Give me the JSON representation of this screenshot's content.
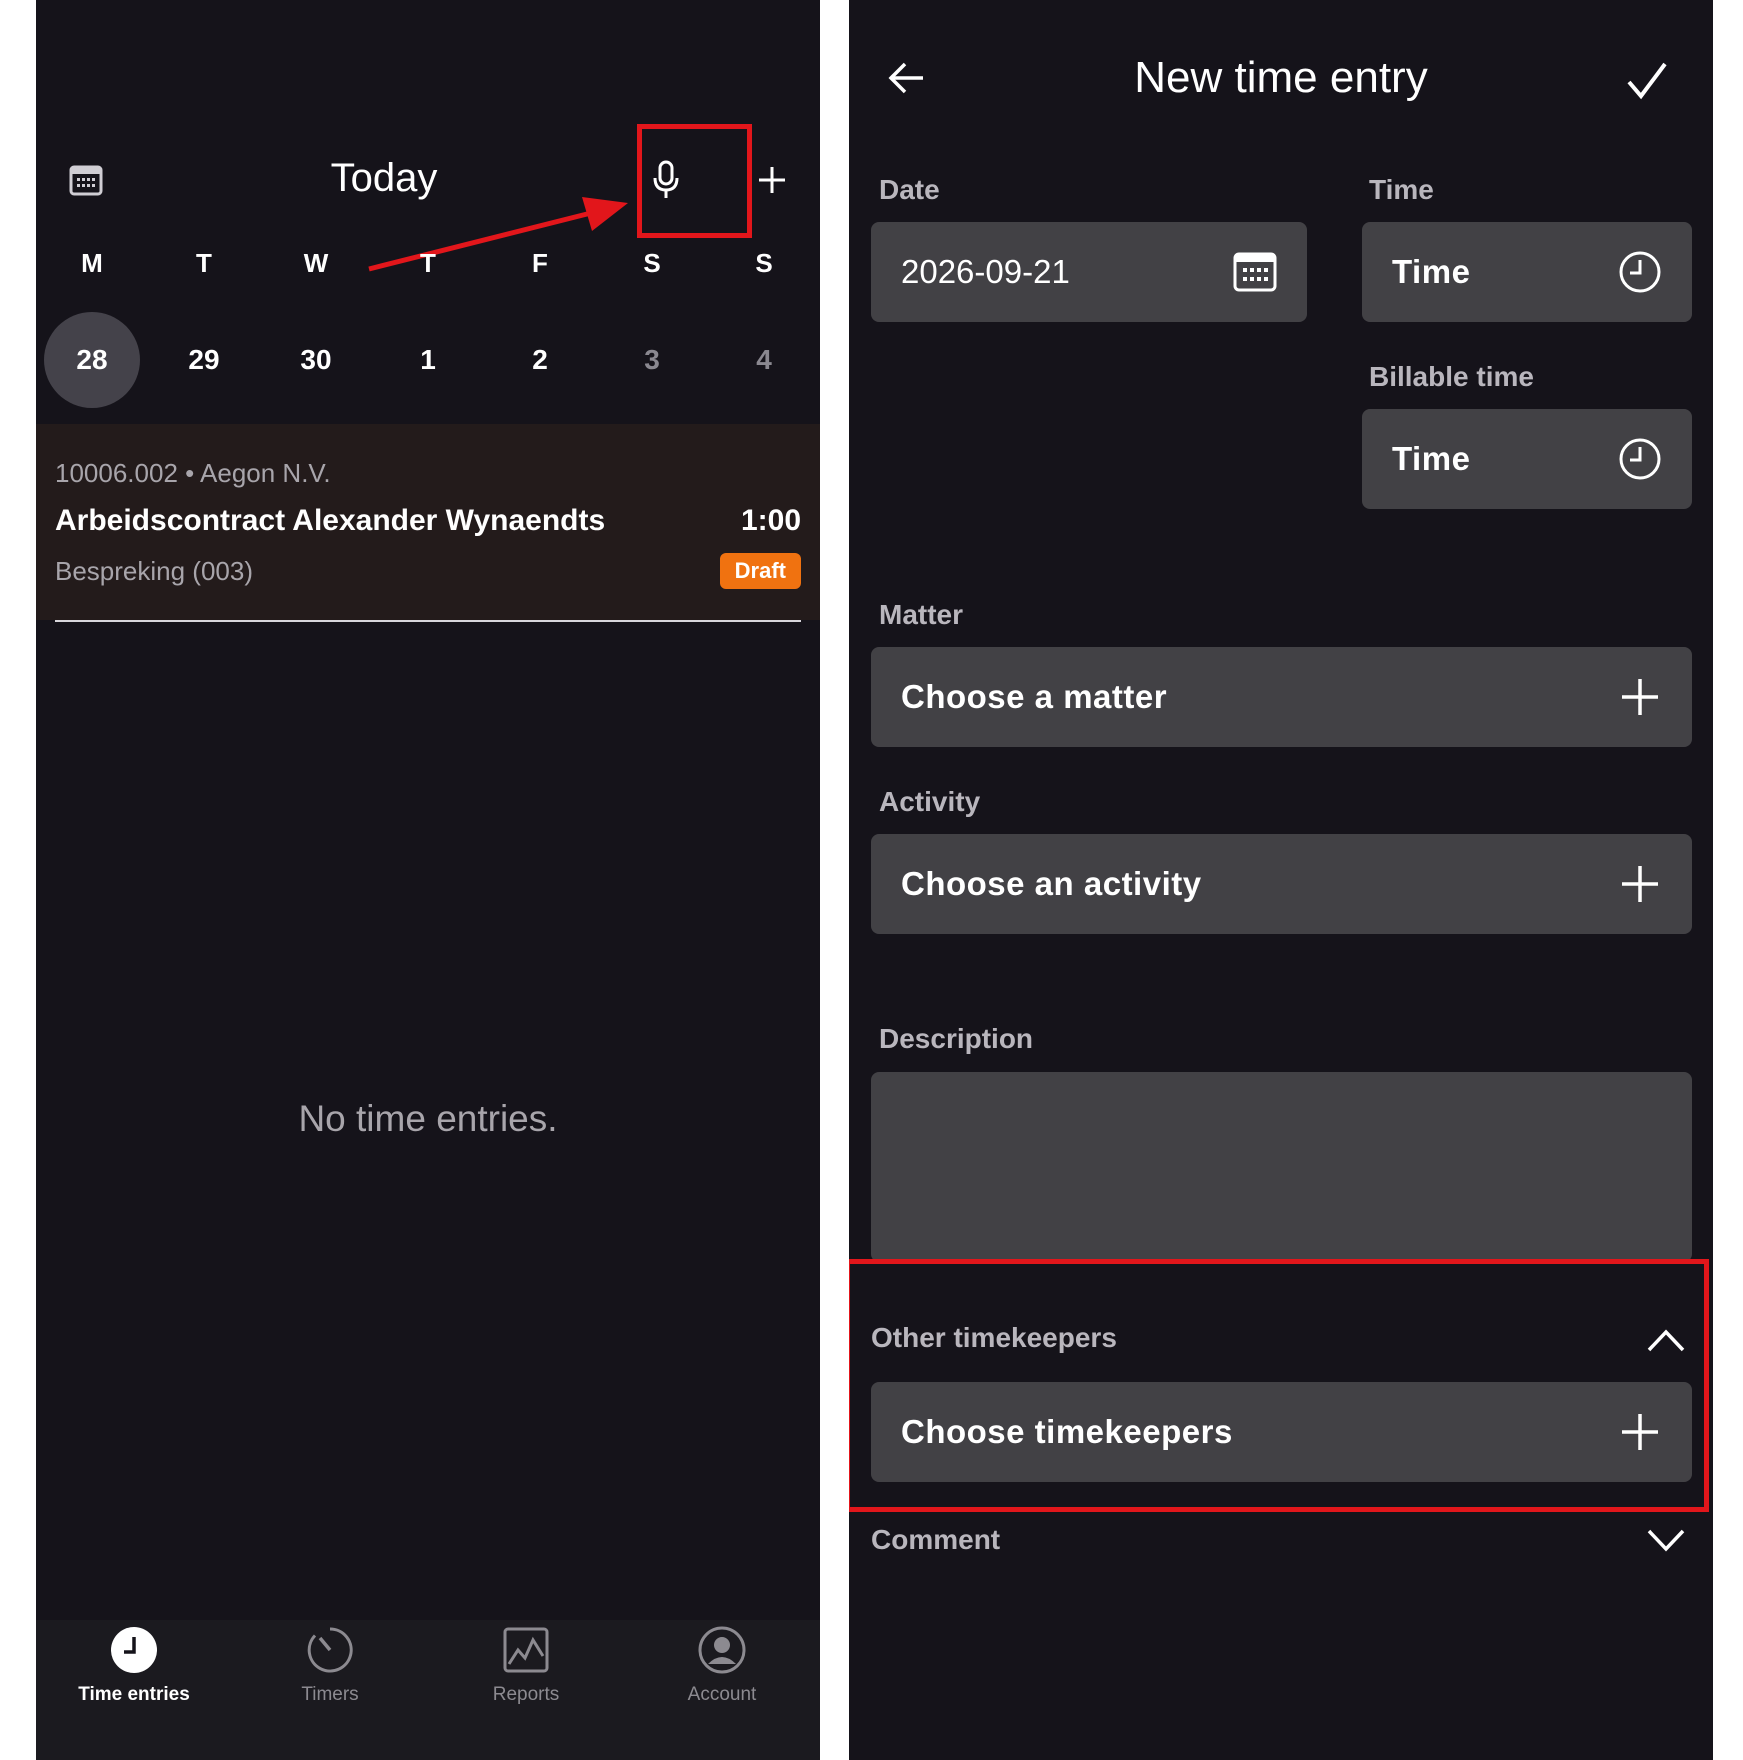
{
  "left_screen": {
    "header": {
      "title": "Today",
      "calendar_icon": "calendar-icon",
      "mic_icon": "microphone-icon",
      "add_icon": "plus-icon"
    },
    "week": {
      "day_letters": [
        "M",
        "T",
        "W",
        "T",
        "F",
        "S",
        "S"
      ],
      "day_numbers": [
        "28",
        "29",
        "30",
        "1",
        "2",
        "3",
        "4"
      ],
      "selected_index": 0
    },
    "entry": {
      "meta": "10006.002 • Aegon N.V.",
      "title": "Arbeidscontract Alexander Wynaendts",
      "duration": "1:00",
      "activity": "Bespreking (003)",
      "status": "Draft",
      "status_color": "#f07210"
    },
    "empty_message": "No time entries.",
    "bottom_nav": [
      {
        "label": "Time entries",
        "icon": "clock-icon",
        "active": true
      },
      {
        "label": "Timers",
        "icon": "timer-icon",
        "active": false
      },
      {
        "label": "Reports",
        "icon": "chart-icon",
        "active": false
      },
      {
        "label": "Account",
        "icon": "account-icon",
        "active": false
      }
    ]
  },
  "right_screen": {
    "header": {
      "title": "New time entry",
      "back_icon": "arrow-left-icon",
      "confirm_icon": "checkmark-icon"
    },
    "date": {
      "label": "Date",
      "value": "2026-09-21",
      "icon": "calendar-icon"
    },
    "time": {
      "label": "Time",
      "placeholder": "Time",
      "icon": "clock-icon"
    },
    "billable_time": {
      "label": "Billable time",
      "placeholder": "Time",
      "icon": "clock-icon"
    },
    "matter": {
      "label": "Matter",
      "placeholder": "Choose a matter",
      "icon": "plus-icon"
    },
    "activity": {
      "label": "Activity",
      "placeholder": "Choose an activity",
      "icon": "plus-icon"
    },
    "description": {
      "label": "Description",
      "value": ""
    },
    "other_timekeepers": {
      "label": "Other timekeepers",
      "placeholder": "Choose timekeepers",
      "expanded": true
    },
    "comment": {
      "label": "Comment",
      "expanded": false
    }
  },
  "annotation_color": "#e2161b"
}
